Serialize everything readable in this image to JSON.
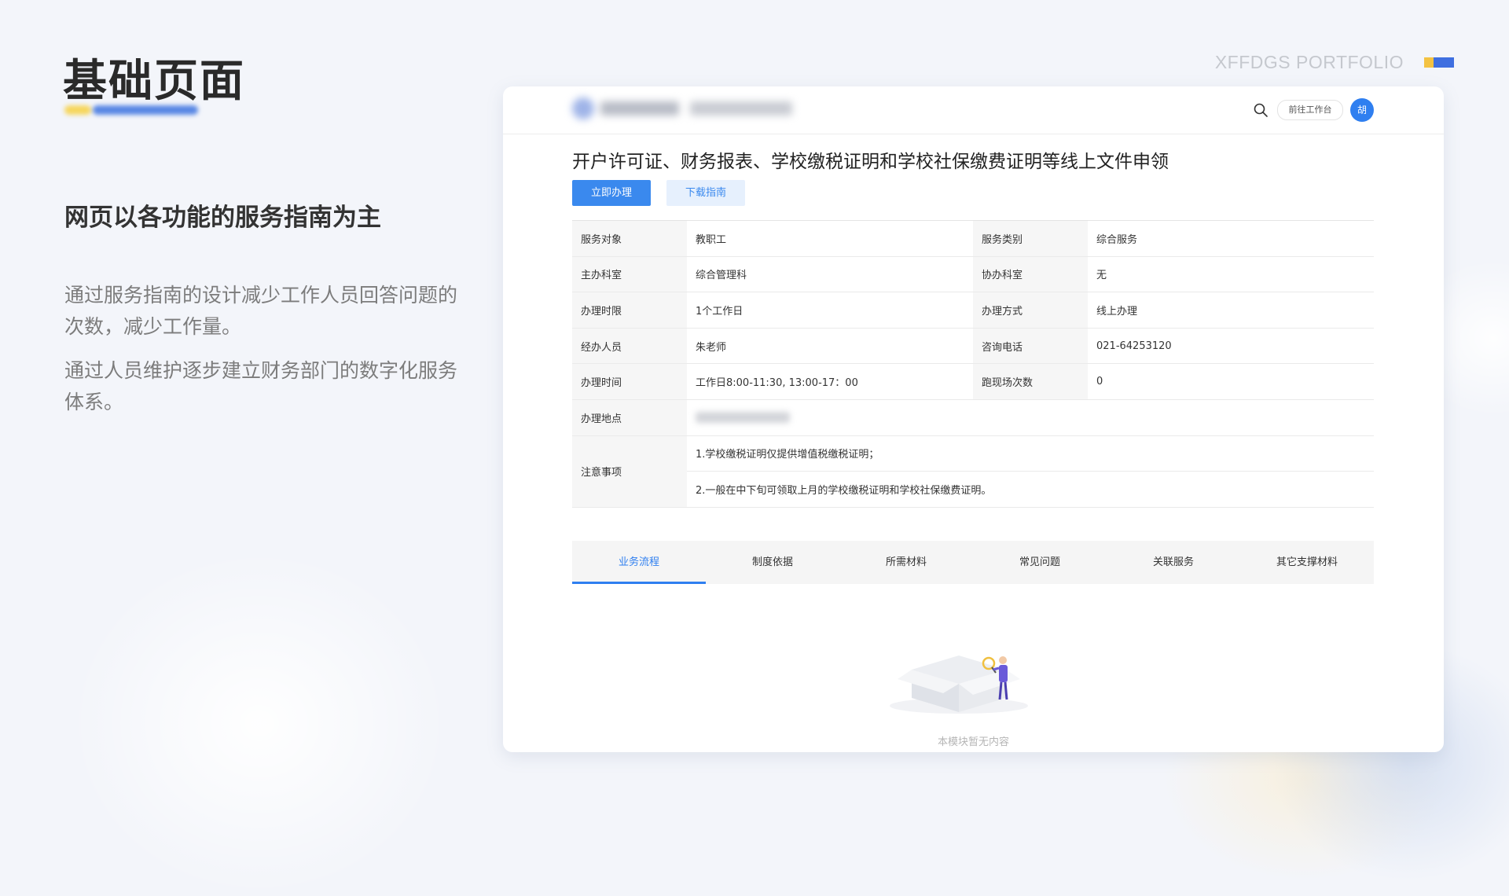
{
  "slide": {
    "title": "基础页面",
    "subtitle": "网页以各功能的服务指南为主",
    "paragraphs": [
      "通过服务指南的设计减少工作人员回答问题的次数，减少工作量。",
      "通过人员维护逐步建立财务部门的数字化服务体系。"
    ],
    "portfolio_label": "XFFDGS PORTFOLIO"
  },
  "header": {
    "search_icon": "search-icon",
    "workbench_label": "前往工作台",
    "avatar_text": "胡"
  },
  "service": {
    "title": "开户许可证、财务报表、学校缴税证明和学校社保缴费证明等线上文件申领",
    "apply_label": "立即办理",
    "download_label": "下载指南"
  },
  "info": {
    "rows": [
      {
        "k1": "服务对象",
        "v1": "教职工",
        "k2": "服务类别",
        "v2": "综合服务"
      },
      {
        "k1": "主办科室",
        "v1": "综合管理科",
        "k2": "协办科室",
        "v2": "无"
      },
      {
        "k1": "办理时限",
        "v1": "1个工作日",
        "k2": "办理方式",
        "v2": "线上办理"
      },
      {
        "k1": "经办人员",
        "v1": "朱老师",
        "k2": "咨询电话",
        "v2": "021-64253120"
      },
      {
        "k1": "办理时间",
        "v1": "工作日8:00-11:30, 13:00-17：00",
        "k2": "跑现场次数",
        "v2": "0"
      }
    ],
    "address_label": "办理地点",
    "notes_label": "注意事项",
    "notes": [
      "1.学校缴税证明仅提供增值税缴税证明；",
      "2.一般在中下旬可领取上月的学校缴税证明和学校社保缴费证明。"
    ]
  },
  "tabs": [
    "业务流程",
    "制度依据",
    "所需材料",
    "常见问题",
    "关联服务",
    "其它支撑材料"
  ],
  "active_tab": 0,
  "empty_state": {
    "text": "本模块暂无内容"
  },
  "colors": {
    "primary": "#2f7ff0",
    "button_primary": "#3a89ee",
    "accent_yellow": "#f3c242",
    "accent_blue": "#3f6fe0"
  }
}
